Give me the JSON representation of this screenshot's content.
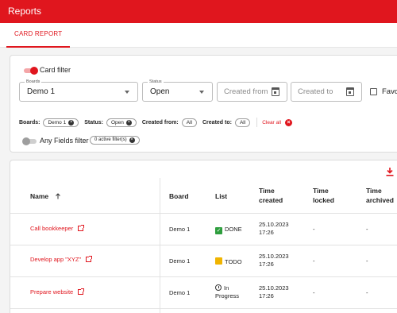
{
  "app": {
    "title": "Reports"
  },
  "tabs": [
    {
      "label": "CARD REPORT",
      "active": true
    }
  ],
  "filters": {
    "card_filter_label": "Card filter",
    "card_filter_on": true,
    "boards": {
      "label": "Boards",
      "value": "Demo 1"
    },
    "status": {
      "label": "Status",
      "value": "Open"
    },
    "created_from": {
      "placeholder": "Created from"
    },
    "created_to": {
      "placeholder": "Created to"
    },
    "favorites_label": "Favo",
    "applied": {
      "boards_label": "Boards:",
      "boards_chip": "Demo 1",
      "status_label": "Status:",
      "status_chip": "Open",
      "created_from_label": "Created from:",
      "created_from_chip": "All",
      "created_to_label": "Created to:",
      "created_to_chip": "All",
      "clear_all": "Clear all"
    },
    "any_fields_label": "Any Fields filter",
    "any_fields_on": false,
    "active_filters_chip": "0 active filter(s)"
  },
  "table": {
    "columns": {
      "name": "Name",
      "board": "Board",
      "list": "List",
      "time_created_1": "Time",
      "time_created_2": "created",
      "time_locked_1": "Time",
      "time_locked_2": "locked",
      "time_archived_1": "Time",
      "time_archived_2": "archived"
    },
    "rows": [
      {
        "name": "Call bookkeeper",
        "board": "Demo 1",
        "list": "DONE",
        "list_icon": "check-icon",
        "created_date": "25.10.2023",
        "created_time": "17:26",
        "locked": "-",
        "archived": "-"
      },
      {
        "name": "Develop app \"XYZ\"",
        "board": "Demo 1",
        "list": "TODO",
        "list_icon": "todo-icon",
        "created_date": "25.10.2023",
        "created_time": "17:26",
        "locked": "-",
        "archived": "-"
      },
      {
        "name": "Prepare website",
        "board": "Demo 1",
        "list_line1": "In",
        "list_line2": "Progress",
        "list_icon": "in-progress-icon",
        "created_date": "25.10.2023",
        "created_time": "17:26",
        "locked": "-",
        "archived": "-"
      }
    ]
  },
  "colors": {
    "accent": "#e0161e",
    "done": "#2e9e3e",
    "todo": "#f0b400"
  }
}
